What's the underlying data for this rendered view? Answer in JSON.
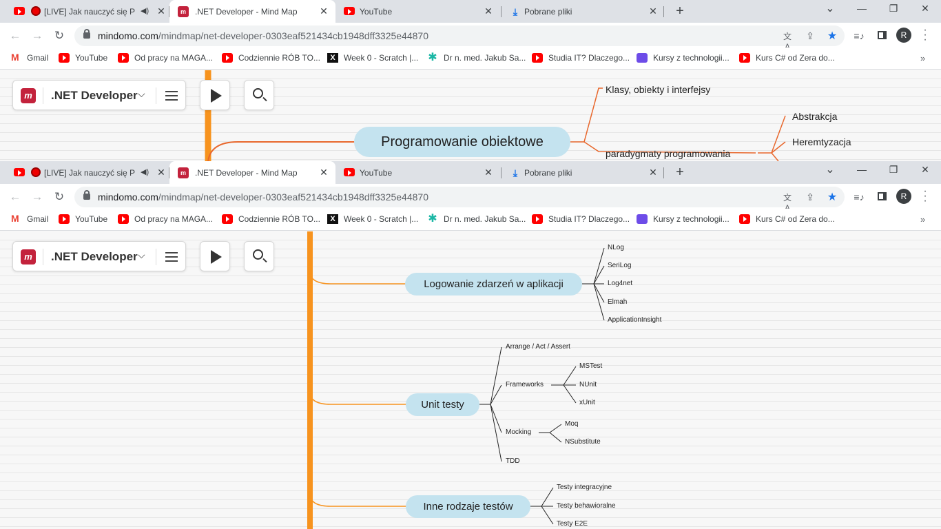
{
  "browser": {
    "tabs": [
      {
        "label": "[LIVE] Jak nauczyć się Pro",
        "icon": "youtube-icon",
        "audio": true,
        "close": "✕"
      },
      {
        "label": ".NET Developer - Mind Map",
        "icon": "mindomo-icon",
        "active": true,
        "close": "✕"
      },
      {
        "label": "YouTube",
        "icon": "youtube-icon",
        "close": "✕"
      },
      {
        "label": "Pobrane pliki",
        "icon": "download-icon",
        "close": "✕"
      }
    ],
    "new_tab": "+",
    "window_controls": {
      "list": "⌄",
      "minimize": "—",
      "restore": "❐",
      "close": "✕"
    },
    "url_host": "mindomo.com",
    "url_path": "/mindmap/net-developer-0303eaf521434cb1948dff3325e44870",
    "profile_initial": "R",
    "bookmarks": [
      {
        "label": "Gmail",
        "icon": "gmail-icon"
      },
      {
        "label": "YouTube",
        "icon": "youtube-icon"
      },
      {
        "label": "Od pracy na MAGA...",
        "icon": "youtube-icon"
      },
      {
        "label": "Codziennie RÓB TO...",
        "icon": "youtube-icon"
      },
      {
        "label": "Week 0 - Scratch |...",
        "icon": "x-icon"
      },
      {
        "label": "Dr n. med. Jakub Sa...",
        "icon": "dr-icon"
      },
      {
        "label": "Studia IT? Dlaczego...",
        "icon": "youtube-icon"
      },
      {
        "label": "Kursy z technologii...",
        "icon": "kursy-icon"
      },
      {
        "label": "Kurs C# od Zera do...",
        "icon": "youtube-icon"
      }
    ],
    "bookmarks_more": "»"
  },
  "toolbar": {
    "map_title": ".NET Developer",
    "dropdown": "⌵",
    "logo": "m"
  },
  "map1": {
    "central": "Programowanie obiektowe",
    "leaves": [
      "Klasy, obiekty i interfejsy",
      "paradygmaty programowania"
    ],
    "sub": [
      "Abstrakcja",
      "Heremtyzacja"
    ]
  },
  "map2": {
    "logging": {
      "title": "Logowanie zdarzeń w aplikacji",
      "items": [
        "NLog",
        "SeriLog",
        "Log4net",
        "Elmah",
        "ApplicationInsight"
      ]
    },
    "unit": {
      "title": "Unit testy",
      "aaa": "Arrange / Act / Assert",
      "frameworks": "Frameworks",
      "fw_items": [
        "MSTest",
        "NUnit",
        "xUnit"
      ],
      "mocking": "Mocking",
      "mock_items": [
        "Moq",
        "NSubstitute"
      ],
      "tdd": "TDD"
    },
    "other": {
      "title": "Inne rodzaje testów",
      "items": [
        "Testy integracyjne",
        "Testy behawioralne",
        "Testy E2E"
      ]
    }
  },
  "colors": {
    "branch_orange": "#f7931e",
    "node_fill": "#c4e3ef",
    "line_orange": "#e8672c",
    "tab_bar": "#dee1e6"
  }
}
